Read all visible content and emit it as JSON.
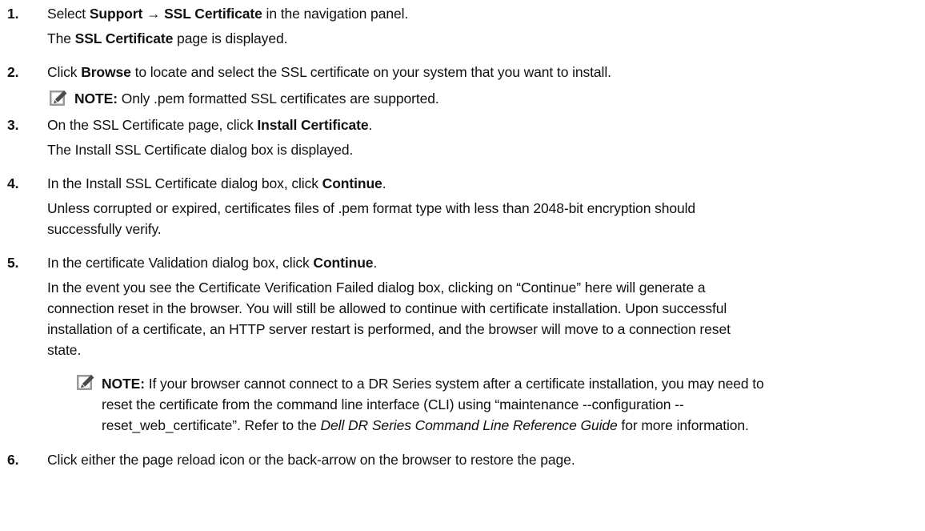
{
  "steps": [
    {
      "number": "1.",
      "instruction": {
        "pre": "Select ",
        "menu_path": "Support → SSL Certificate",
        "post": " in the navigation panel."
      },
      "result": {
        "pre": "The ",
        "bold": "SSL Certificate",
        "post": " page is displayed."
      }
    },
    {
      "number": "2.",
      "instruction": {
        "pre": "Click ",
        "bold": "Browse",
        "post": " to locate and select the SSL certificate on your system that you want to install."
      },
      "note": {
        "label": "NOTE:",
        "text": " Only .pem formatted SSL certificates are supported."
      }
    },
    {
      "number": "3.",
      "instruction": {
        "pre": "On the SSL Certificate page, click ",
        "bold": "Install Certificate",
        "post": "."
      },
      "result": {
        "text": "The Install SSL Certificate dialog box is displayed."
      }
    },
    {
      "number": "4.",
      "instruction": {
        "pre": "In the Install SSL Certificate dialog box, click ",
        "bold": "Continue",
        "post": "."
      },
      "result": {
        "line1": "Unless corrupted or expired, certificates files of .pem format type with less than 2048-bit encryption should",
        "line2": "successfully verify."
      }
    },
    {
      "number": "5.",
      "instruction": {
        "pre": "In the certificate Validation dialog box, click ",
        "bold": "Continue",
        "post": "."
      },
      "result": {
        "line1": "In the event you see the Certificate Verification Failed dialog box, clicking on “Continue” here will generate a",
        "line2": "connection reset in the browser. You will still be allowed to continue with certificate installation. Upon successful",
        "line3": "installation of a certificate, an HTTP server restart is performed, and the browser will move to a connection reset",
        "line4": "state."
      },
      "note": {
        "label": "NOTE:",
        "line1": " If your browser cannot connect to a DR Series system after a certificate installation, you may need to",
        "line2": "reset the certificate from the command line interface (CLI) using “maintenance --configuration --",
        "line3_pre": "reset_web_certificate”. Refer to the ",
        "line3_italic": "Dell DR Series Command Line Reference Guide",
        "line3_post": " for more information."
      }
    },
    {
      "number": "6.",
      "instruction": {
        "text": "Click either the page reload icon or the back-arrow on the browser to restore the page."
      }
    }
  ]
}
